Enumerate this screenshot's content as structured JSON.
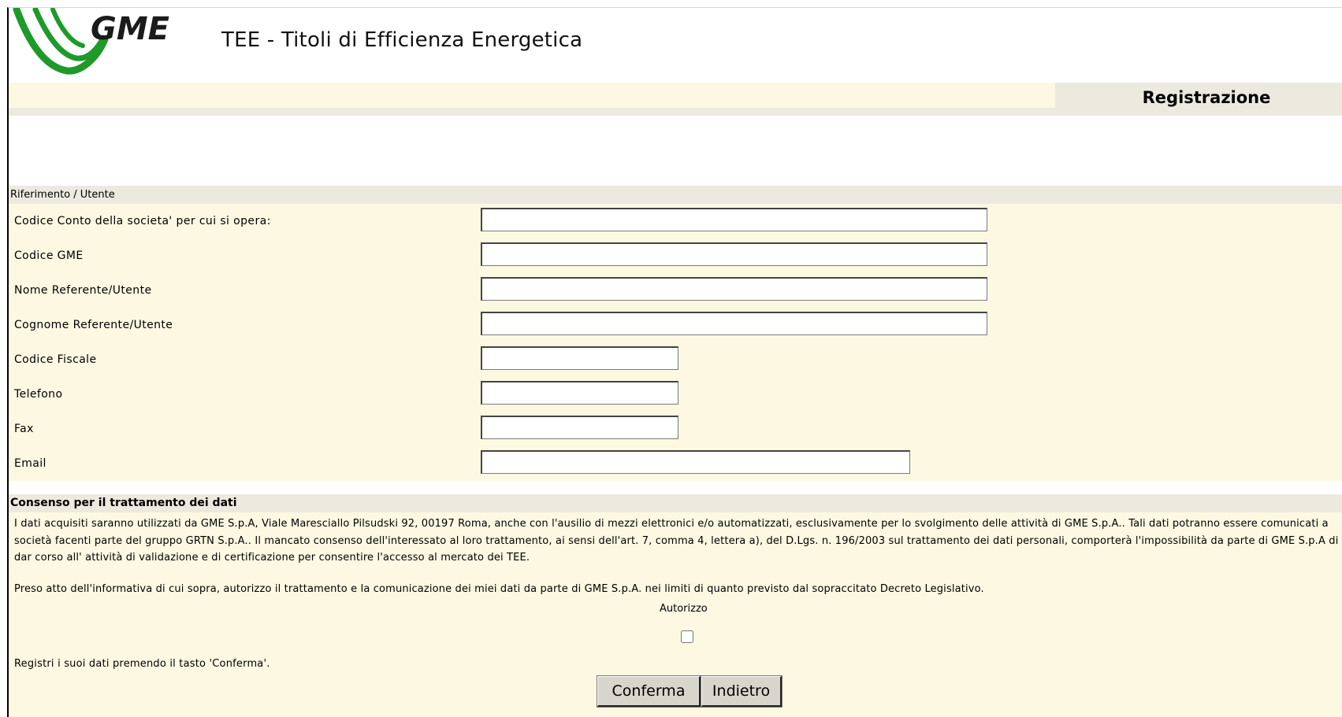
{
  "header": {
    "logo_text": "GME",
    "app_title": "TEE - Titoli di Efficienza Energetica",
    "page_heading": "Registrazione"
  },
  "section_user": {
    "title": "Riferimento / Utente",
    "fields": [
      {
        "label": "Codice Conto della societa' per cui si opera:",
        "value": ""
      },
      {
        "label": "Codice GME",
        "value": ""
      },
      {
        "label": "Nome Referente/Utente",
        "value": ""
      },
      {
        "label": "Cognome Referente/Utente",
        "value": ""
      },
      {
        "label": "Codice Fiscale",
        "value": ""
      },
      {
        "label": "Telefono",
        "value": ""
      },
      {
        "label": "Fax",
        "value": ""
      },
      {
        "label": "Email",
        "value": ""
      }
    ]
  },
  "consent": {
    "title": "Consenso per il trattamento dei dati",
    "text": "I dati acquisiti saranno utilizzati da GME S.p.A, Viale Maresciallo Pilsudski 92, 00197 Roma, anche con l'ausilio di mezzi elettronici e/o automatizzati, esclusivamente per lo svolgimento delle attività di GME S.p.A.. Tali dati potranno essere comunicati a società facenti parte del gruppo GRTN S.p.A.. Il mancato consenso dell'interessato al loro trattamento, ai sensi dell'art. 7, comma 4, lettera a), del D.Lgs. n. 196/2003 sul trattamento dei dati personali, comporterà l'impossibilità da parte di GME S.p.A di dar corso all' attività di validazione e di certificazione per consentire l'accesso al mercato dei TEE.",
    "authorization_text": "Preso atto dell'informativa di cui sopra, autorizzo il trattamento e la comunicazione dei miei dati da parte di GME S.p.A. nei limiti di quanto previsto dal sopraccitato Decreto Legislativo.",
    "checkbox_label": "Autorizzo",
    "checked": false,
    "register_hint": "Registri i suoi dati premendo il tasto 'Conferma'."
  },
  "buttons": {
    "confirm": "Conferma",
    "back": "Indietro"
  },
  "colors": {
    "row_background": "#fcf8e2",
    "header_background": "#ece9df",
    "logo_green": "#1e9a2a"
  }
}
